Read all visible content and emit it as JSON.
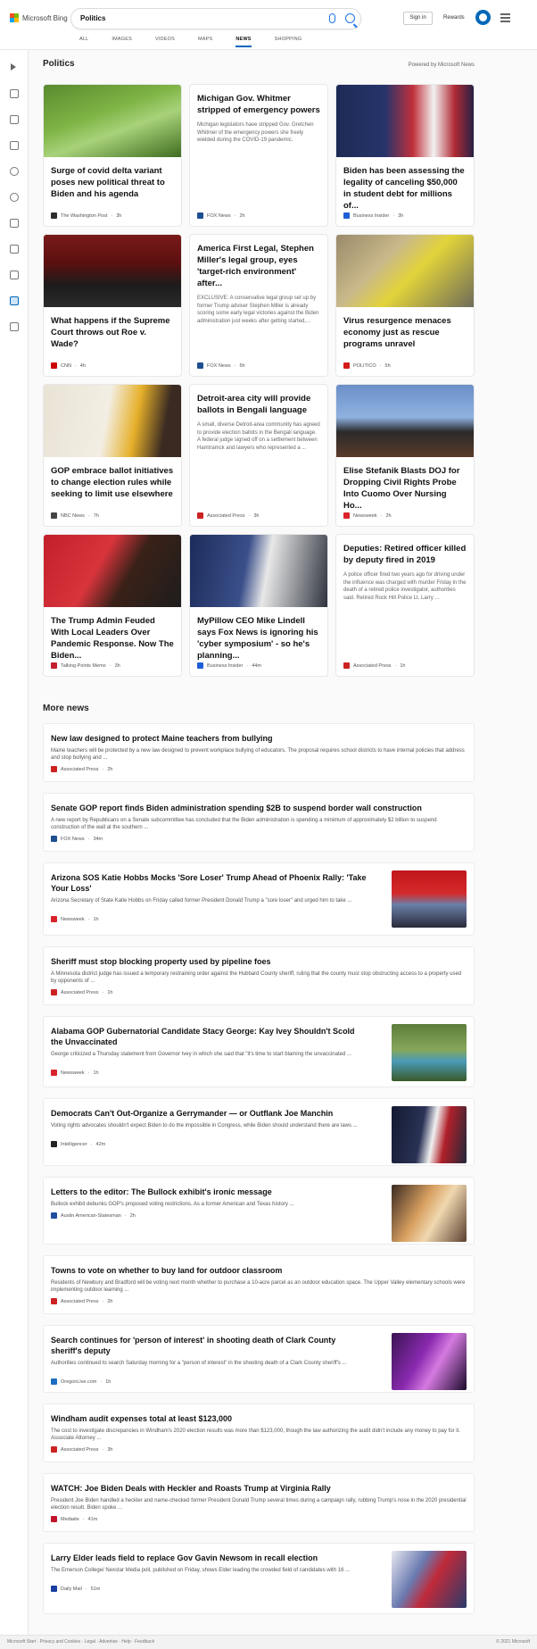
{
  "header": {
    "logo": "Microsoft Bing",
    "query": "Politics",
    "signin": "Sign in",
    "rewards": "Rewards",
    "tabs": [
      "ALL",
      "IMAGES",
      "VIDEOS",
      "MAPS",
      "NEWS",
      "SHOPPING"
    ],
    "active_tab": "NEWS"
  },
  "colors": {
    "accent": "#0067b8",
    "brand_blue": "#1a73e8"
  },
  "sidebar_icons": [
    "expand-icon",
    "home-icon",
    "trending-icon",
    "flag-icon",
    "location-icon",
    "globe-icon",
    "money-icon",
    "science-icon",
    "entertainment-icon",
    "politics-icon",
    "more-icon"
  ],
  "politics": {
    "title": "Politics",
    "powered": "Powered by Microsoft News",
    "cards": [
      {
        "title": "Surge of covid delta variant poses new political threat to Biden and his agenda",
        "source": "The Washington Post",
        "time": "3h",
        "desc": ""
      },
      {
        "title": "Michigan Gov. Whitmer stripped of emergency powers",
        "source": "FOX News",
        "time": "2h",
        "desc": "Michigan legislators have stripped Gov. Gretchen Whitmer of the emergency powers she freely wielded during the COVID-19 pandemic."
      },
      {
        "title": "Biden has been assessing the legality of canceling $50,000 in student debt for millions of...",
        "source": "Business Insider",
        "time": "3h",
        "desc": ""
      },
      {
        "title": "What happens if the Supreme Court throws out Roe v. Wade?",
        "source": "CNN",
        "time": "4h",
        "desc": ""
      },
      {
        "title": "America First Legal, Stephen Miller's legal group, eyes 'target-rich environment' after...",
        "source": "FOX News",
        "time": "5h",
        "desc": "EXCLUSIVE: A conservative legal group set up by former Trump adviser Stephen Miller is already scoring some early legal victories against the Biden administration just weeks after getting started,..."
      },
      {
        "title": "Virus resurgence menaces economy just as rescue programs unravel",
        "source": "POLITICO",
        "time": "5h",
        "desc": ""
      },
      {
        "title": "GOP embrace ballot initiatives to change election rules while seeking to limit use elsewhere",
        "source": "NBC News",
        "time": "7h",
        "desc": ""
      },
      {
        "title": "Detroit-area city will provide ballots in Bengali language",
        "source": "Associated Press",
        "time": "3h",
        "desc": "A small, diverse Detroit-area community has agreed to provide election ballots in the Bengali language. A federal judge signed off on a settlement between Hamtramck and lawyers who represented a ..."
      },
      {
        "title": "Elise Stefanik Blasts DOJ for Dropping Civil Rights Probe Into Cuomo Over Nursing Ho...",
        "source": "Newsweek",
        "time": "2h",
        "desc": ""
      },
      {
        "title": "The Trump Admin Feuded With Local Leaders Over Pandemic Response. Now The Biden...",
        "source": "Talking Points Memo",
        "time": "3h",
        "desc": ""
      },
      {
        "title": "MyPillow CEO Mike Lindell says Fox News is ignoring his 'cyber symposium' - so he's planning...",
        "source": "Business Insider",
        "time": "44m",
        "desc": ""
      },
      {
        "title": "Deputies: Retired officer killed by deputy fired in 2019",
        "source": "Associated Press",
        "time": "1h",
        "desc": "A police officer fired two years ago for driving under the influence was charged with murder Friday in the death of a retired police investigator, authorities said. Retired Rock Hill Police Lt. Larry ..."
      }
    ]
  },
  "more_news": {
    "title": "More news",
    "items": [
      {
        "title": "New law designed to protect Maine teachers from bullying",
        "desc": "Maine teachers will be protected by a new law designed to prevent workplace bullying of educators. The proposal requires school districts to have internal policies that address and stop bullying and ...",
        "source": "Associated Press",
        "time": "2h"
      },
      {
        "title": "Senate GOP report finds Biden administration spending $2B to suspend border wall construction",
        "desc": "A new report by Republicans on a Senate subcommittee has concluded that the Biden administration is spending a minimum of approximately $2 billion to suspend construction of the wall at the southern ...",
        "source": "FOX News",
        "time": "34m"
      },
      {
        "title": "Arizona SOS Katie Hobbs Mocks 'Sore Loser' Trump Ahead of Phoenix Rally: 'Take Your Loss'",
        "desc": "Arizona Secretary of State Katie Hobbs on Friday called former President Donald Trump a \"sore loser\" and urged him to take ...",
        "source": "Newsweek",
        "time": "1h"
      },
      {
        "title": "Sheriff must stop blocking property used by pipeline foes",
        "desc": "A Minnesota district judge has issued a temporary restraining order against the Hubbard County sheriff, ruling that the county must stop obstructing access to a property used by opponents of ...",
        "source": "Associated Press",
        "time": "1h"
      },
      {
        "title": "Alabama GOP Gubernatorial Candidate Stacy George: Kay Ivey Shouldn't Scold the Unvaccinated",
        "desc": "George criticized a Thursday statement from Governor Ivey in which she said that \"it's time to start blaming the unvaccinated ...",
        "source": "Newsweek",
        "time": "1h"
      },
      {
        "title": "Democrats Can't Out-Organize a Gerrymander — or Outflank Joe Manchin",
        "desc": "Voting rights advocates shouldn't expect Biden to do the impossible in Congress, while Biden should understand there are laws ...",
        "source": "Intelligencer",
        "time": "42m"
      },
      {
        "title": "Letters to the editor: The Bullock exhibit's ironic message",
        "desc": "Bullock exhibit debunks GOP's proposed voting restrictions. As a former American and Texas history ...",
        "source": "Austin American-Statesman",
        "time": "2h"
      },
      {
        "title": "Towns to vote on whether to buy land for outdoor classroom",
        "desc": "Residents of Newbury and Bradford will be voting next month whether to purchase a 10-acre parcel as an outdoor education space. The Upper Valley elementary schools were implementing outdoor learning ...",
        "source": "Associated Press",
        "time": "2h"
      },
      {
        "title": "Search continues for 'person of interest' in shooting death of Clark County sheriff's deputy",
        "desc": "Authorities continued to search Saturday morning for a \"person of interest\" in the shooting death of a Clark County sheriff's ...",
        "source": "OregonLive.com",
        "time": "1h"
      },
      {
        "title": "Windham audit expenses total at least $123,000",
        "desc": "The cost to investigate discrepancies in Windham's 2020 election results was more than $123,000, though the law authorizing the audit didn't include any money to pay for it. Associate Attorney ...",
        "source": "Associated Press",
        "time": "3h"
      },
      {
        "title": "WATCH: Joe Biden Deals with Heckler and Roasts Trump at Virginia Rally",
        "desc": "President Joe Biden handled a heckler and name-checked former President Donald Trump several times during a campaign rally, rubbing Trump's nose in the 2020 presidential election result. Biden spoke ...",
        "source": "Mediaite",
        "time": "41m"
      },
      {
        "title": "Larry Elder leads field to replace Gov Gavin Newsom in recall election",
        "desc": "The Emerson College/ Nexstar Media poll, published on Friday, shows Elder leading the crowded field of candidates with 16 ...",
        "source": "Daily Mail",
        "time": "51m"
      }
    ]
  },
  "footer": {
    "left": "Microsoft Start  ·  Privacy and Cookies  ·  Legal  ·  Advertise  ·  Help  ·  Feedback",
    "right": "© 2021 Microsoft"
  }
}
